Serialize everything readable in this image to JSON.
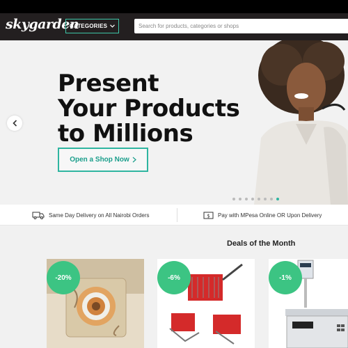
{
  "header": {
    "logo_text": "skygarden",
    "categories_label": "CATEGORIES",
    "search_placeholder": "Search for products, categories or shops"
  },
  "hero": {
    "title_lines": [
      "Present",
      "Your Products",
      "to Millions"
    ],
    "cta_label": "Open a Shop Now",
    "slide_count": 8,
    "active_slide": 8
  },
  "usp": {
    "delivery": "Same Day Delivery on All Nairobi Orders",
    "payment": "Pay with MPesa Online OR Upon Delivery"
  },
  "deals": {
    "title": "Deals of the Month",
    "items": [
      {
        "discount": "-20%",
        "product": "cushion"
      },
      {
        "discount": "-6%",
        "product": "vegetable cutter"
      },
      {
        "discount": "-1%",
        "product": "digital scale"
      }
    ]
  },
  "colors": {
    "accent": "#2eb5a0",
    "badge": "#3cc483",
    "header_bg": "#231f20"
  }
}
